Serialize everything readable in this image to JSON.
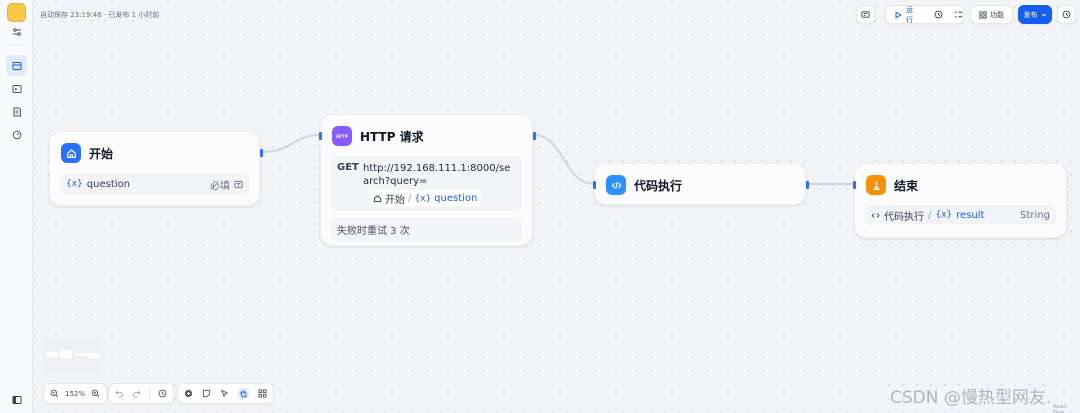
{
  "header": {
    "status": "自动保存 23:19:46 · 已发布 1 小时前",
    "run_label": "运行",
    "features_label": "功能",
    "publish_label": "发布"
  },
  "nodes": {
    "start": {
      "title": "开始",
      "variable": "question",
      "required_label": "必填"
    },
    "http": {
      "title": "HTTP 请求",
      "icon_text": "HTTP",
      "method": "GET",
      "url": "http://192.168.111.1:8000/search?query=",
      "ref_node": "开始",
      "ref_variable": "question",
      "retry": "失败时重试 3 次"
    },
    "code": {
      "title": "代码执行"
    },
    "end": {
      "title": "结束",
      "source_node": "代码执行",
      "variable": "result",
      "type": "String"
    }
  },
  "zoom": {
    "level": "152%"
  },
  "watermark": "CSDN @慢热型网友.",
  "credit": "React Flow",
  "colors": {
    "accent": "#155eef",
    "start_icon": "#2970ff",
    "http_icon": "#875bf7",
    "code_icon": "#2e90fa",
    "end_icon": "#f79009"
  }
}
